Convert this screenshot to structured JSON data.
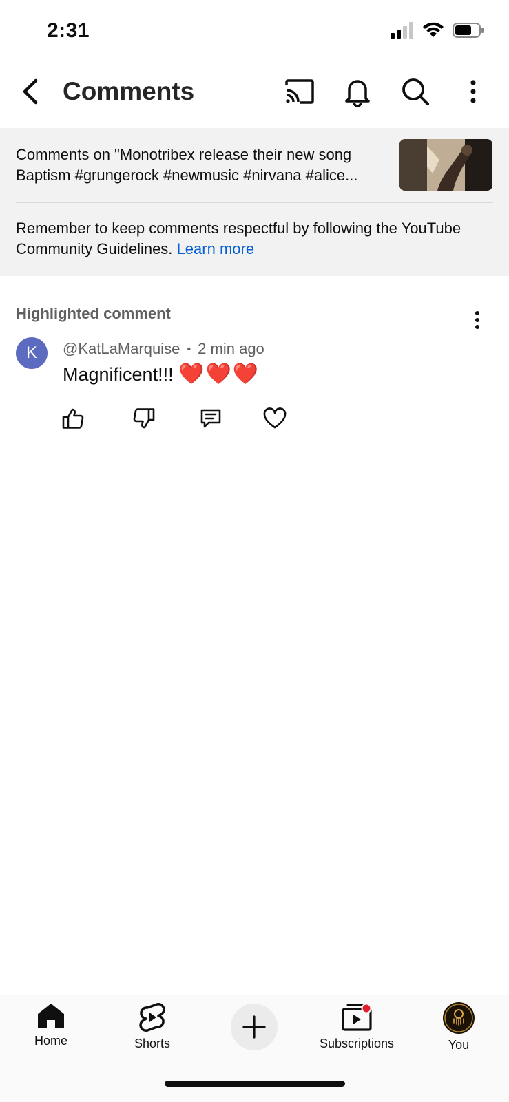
{
  "status_bar": {
    "time": "2:31"
  },
  "header": {
    "title": "Comments",
    "icons": [
      "back-icon",
      "cast-icon",
      "bell-icon",
      "search-icon",
      "more-vertical-icon"
    ]
  },
  "video": {
    "title": "Comments on \"Monotribex release their new song Baptism #grungerock #newmusic #nirvana #alice..."
  },
  "guidelines": {
    "text": "Remember to keep comments respectful by following the YouTube Community Guidelines.",
    "link": "Learn more"
  },
  "highlighted": {
    "label": "Highlighted comment",
    "comment": {
      "avatar_letter": "K",
      "author": "@KatLaMarquise",
      "separator": "•",
      "time": "2 min ago",
      "text": "Magnificent!!!",
      "emoji": "❤️❤️❤️"
    },
    "actions": [
      "thumbs-up-icon",
      "thumbs-down-icon",
      "reply-icon",
      "heart-icon"
    ]
  },
  "colors": {
    "link": "#065fd4",
    "avatar": "#5c6bc0",
    "panel_bg": "#f2f2f2",
    "notification_dot": "#e0202e"
  },
  "bottom_nav": {
    "items": [
      {
        "label": "Home",
        "icon": "home-icon"
      },
      {
        "label": "Shorts",
        "icon": "shorts-icon"
      },
      {
        "label": "",
        "icon": "plus-icon"
      },
      {
        "label": "Subscriptions",
        "icon": "subscriptions-icon"
      },
      {
        "label": "You",
        "icon": "profile-avatar"
      }
    ]
  }
}
